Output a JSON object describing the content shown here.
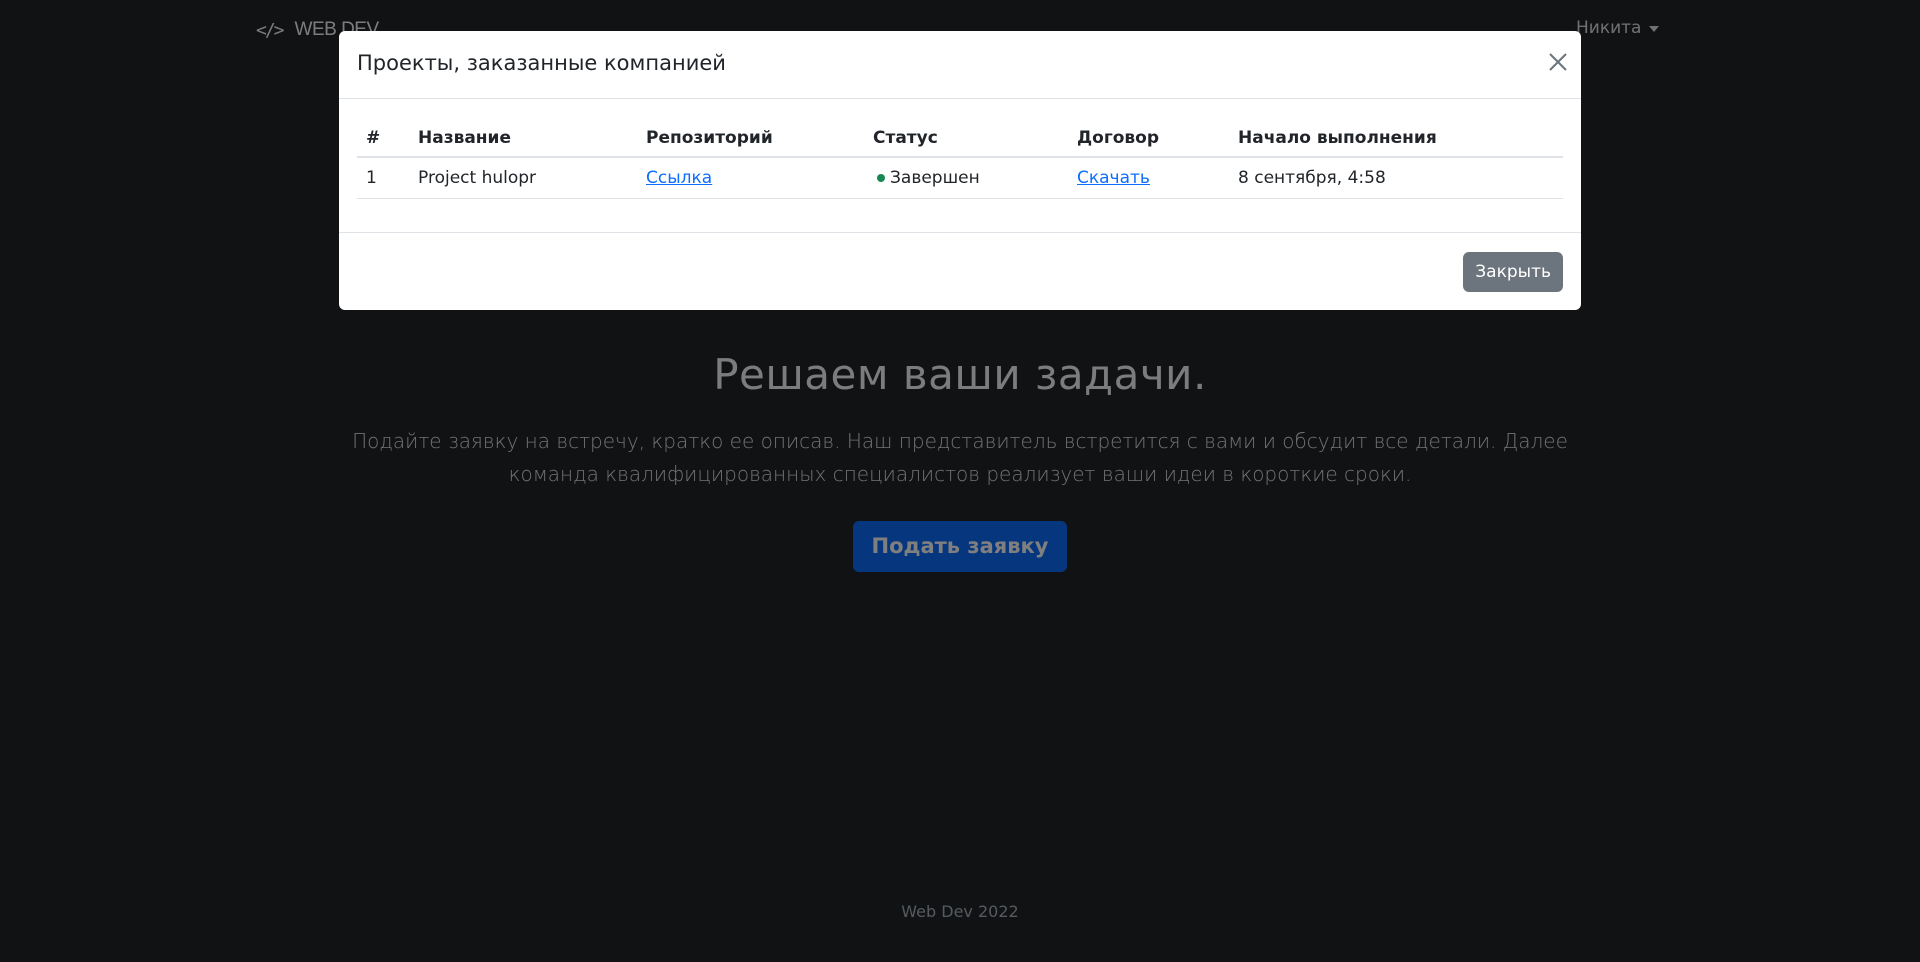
{
  "navbar": {
    "brand_icon": "</>",
    "brand_text": "WEB DEV",
    "user_name": "Никита"
  },
  "hero": {
    "title": "Решаем ваши задачи.",
    "description": "Подайте заявку на встречу, кратко ее описав. Наш представитель встретится с вами и обсудит все детали. Далее команда квалифицированных специалистов реализует ваши идеи в короткие сроки.",
    "button_label": "Подать заявку"
  },
  "footer": {
    "text": "Web Dev 2022"
  },
  "modal": {
    "title": "Проекты, заказанные компанией",
    "columns": [
      "#",
      "Название",
      "Репозиторий",
      "Статус",
      "Договор",
      "Начало выполнения"
    ],
    "rows": [
      {
        "num": "1",
        "name": "Project hulopr",
        "repo_link": "Ссылка",
        "status": "Завершен",
        "contract_link": "Скачать",
        "start": "8 сентября, 4:58"
      }
    ],
    "close_button_label": "Закрыть"
  },
  "colors": {
    "primary": "#0d6efd",
    "secondary": "#6c757d",
    "status_done": "#198754",
    "page_bg": "#212529"
  },
  "icons": {
    "brand": "code-icon",
    "modal_close": "close-icon",
    "user_menu": "chevron-down-icon"
  }
}
